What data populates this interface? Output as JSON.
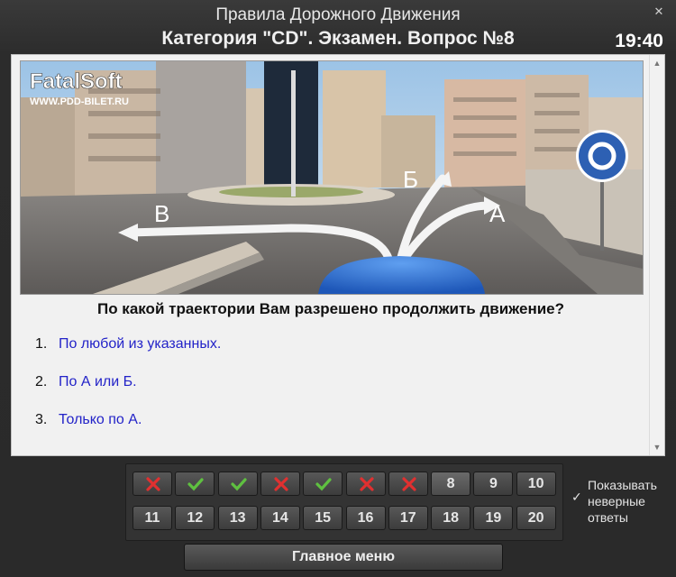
{
  "window": {
    "title": "Правила Дорожного Движения",
    "subtitle": "Категория \"CD\". Экзамен. Вопрос №8",
    "timer": "19:40",
    "close_glyph": "✕"
  },
  "image": {
    "brand": "FatalSoft",
    "site": "WWW.PDD-BILET.RU",
    "label_a": "А",
    "label_b": "Б",
    "label_v": "В"
  },
  "question": {
    "text": "По какой траектории Вам разрешено продолжить движение?",
    "answers": [
      {
        "num": "1.",
        "text": "По любой из указанных."
      },
      {
        "num": "2.",
        "text": "По А или Б."
      },
      {
        "num": "3.",
        "text": "Только по А."
      }
    ]
  },
  "grid": {
    "buttons": [
      {
        "label": "",
        "state": "wrong"
      },
      {
        "label": "",
        "state": "correct"
      },
      {
        "label": "",
        "state": "correct"
      },
      {
        "label": "",
        "state": "wrong"
      },
      {
        "label": "",
        "state": "correct"
      },
      {
        "label": "",
        "state": "wrong"
      },
      {
        "label": "",
        "state": "wrong"
      },
      {
        "label": "8",
        "state": "current"
      },
      {
        "label": "9",
        "state": "pending"
      },
      {
        "label": "10",
        "state": "pending"
      },
      {
        "label": "11",
        "state": "pending"
      },
      {
        "label": "12",
        "state": "pending"
      },
      {
        "label": "13",
        "state": "pending"
      },
      {
        "label": "14",
        "state": "pending"
      },
      {
        "label": "15",
        "state": "pending"
      },
      {
        "label": "16",
        "state": "pending"
      },
      {
        "label": "17",
        "state": "pending"
      },
      {
        "label": "18",
        "state": "pending"
      },
      {
        "label": "19",
        "state": "pending"
      },
      {
        "label": "20",
        "state": "pending"
      }
    ],
    "colors": {
      "wrong": "#e03030",
      "correct": "#5fc040"
    }
  },
  "show_wrong": {
    "label": "Показывать неверные ответы",
    "checked": true,
    "check_glyph": "✓"
  },
  "main_menu_label": "Главное меню"
}
